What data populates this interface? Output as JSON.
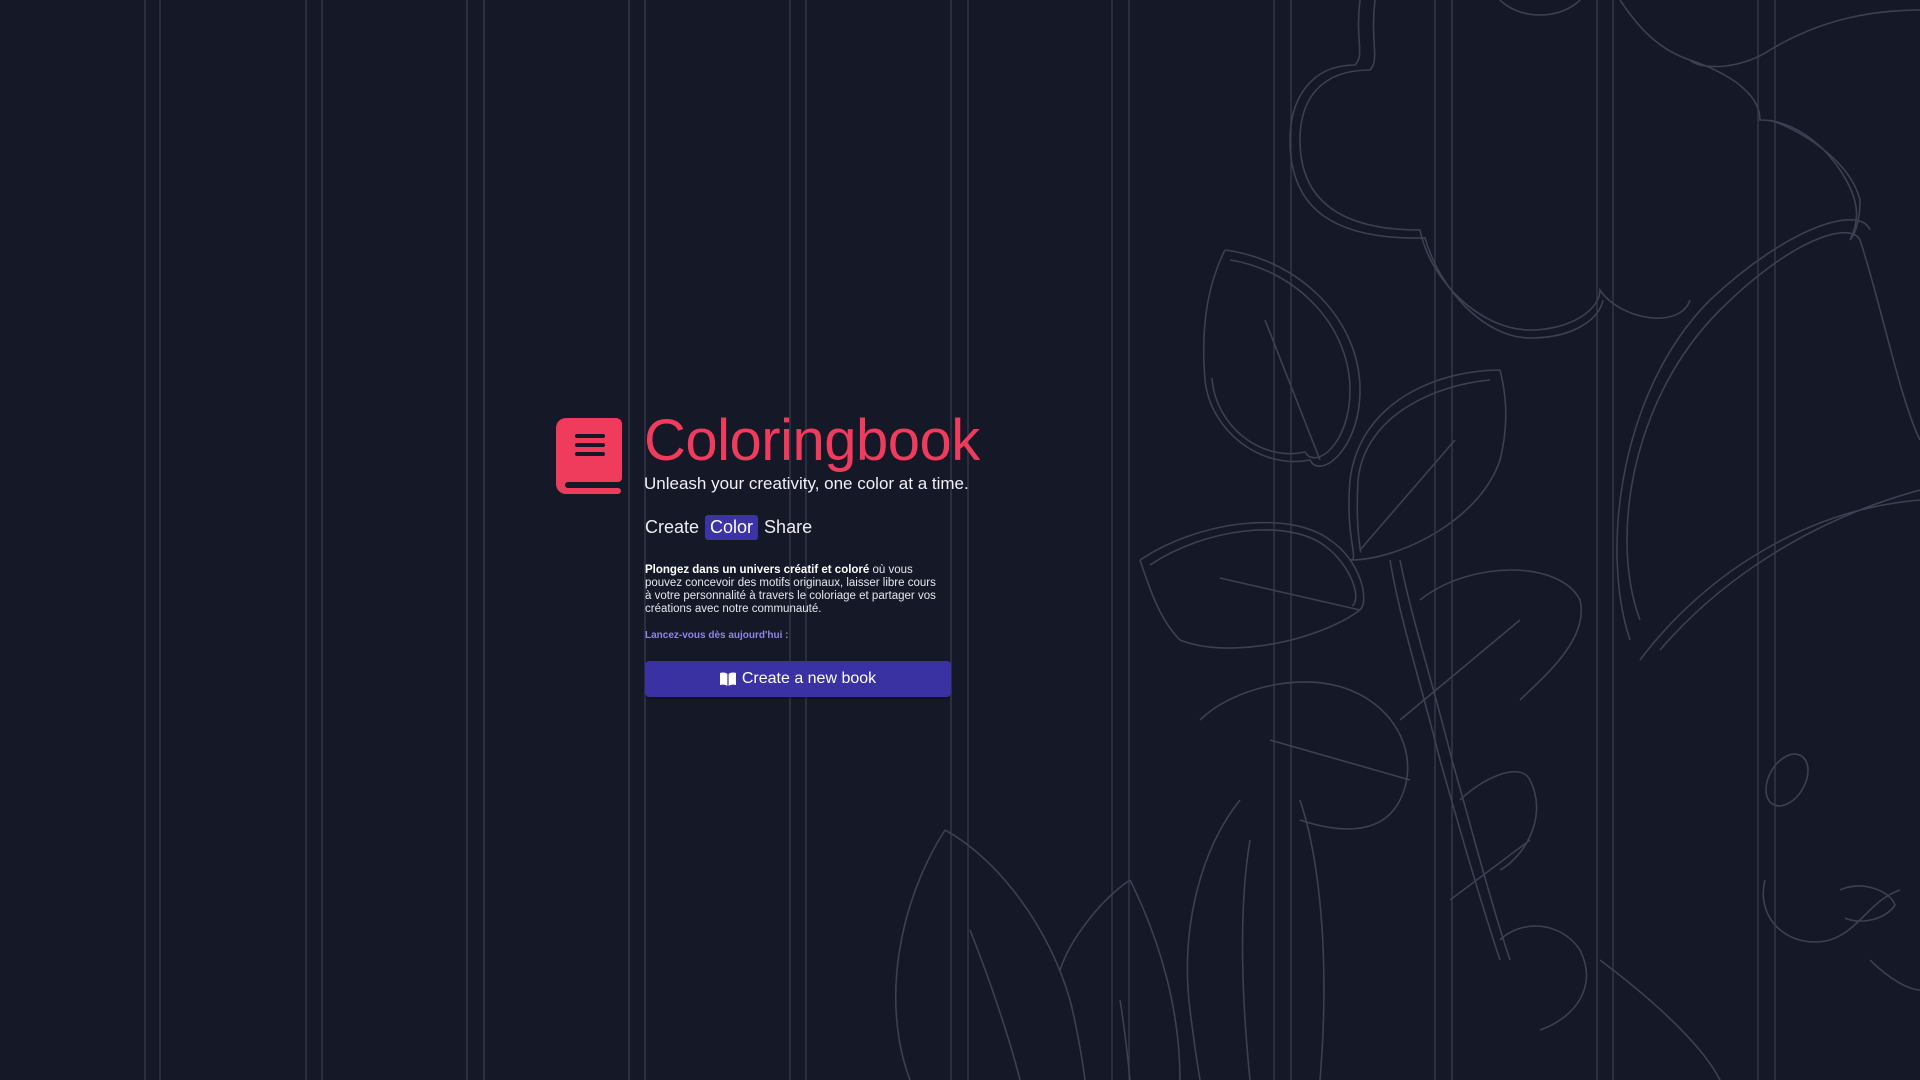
{
  "brand": {
    "title": "Coloringbook",
    "tagline": "Unleash your creativity, one color at a time.",
    "logo_icon": "book-icon",
    "accent_color": "#ef3b5c"
  },
  "steps": {
    "create": "Create",
    "color": "Color",
    "share": "Share",
    "active_step": "Color",
    "active_color": "#3b33a6"
  },
  "intro": {
    "bold": "Plongez dans un univers créatif et coloré",
    "rest": " où vous pouvez concevoir des motifs originaux, laisser libre cours à votre personnalité à travers le coloriage et partager vos créations avec notre communauté."
  },
  "cta": {
    "label": "Lancez-vous dès aujourd'hui :",
    "button_label": "Create a new book",
    "button_icon": "open-book-icon",
    "button_color": "#3a31a3"
  },
  "background": {
    "color": "#151826",
    "decoration": "flower-and-leaves-outline"
  }
}
